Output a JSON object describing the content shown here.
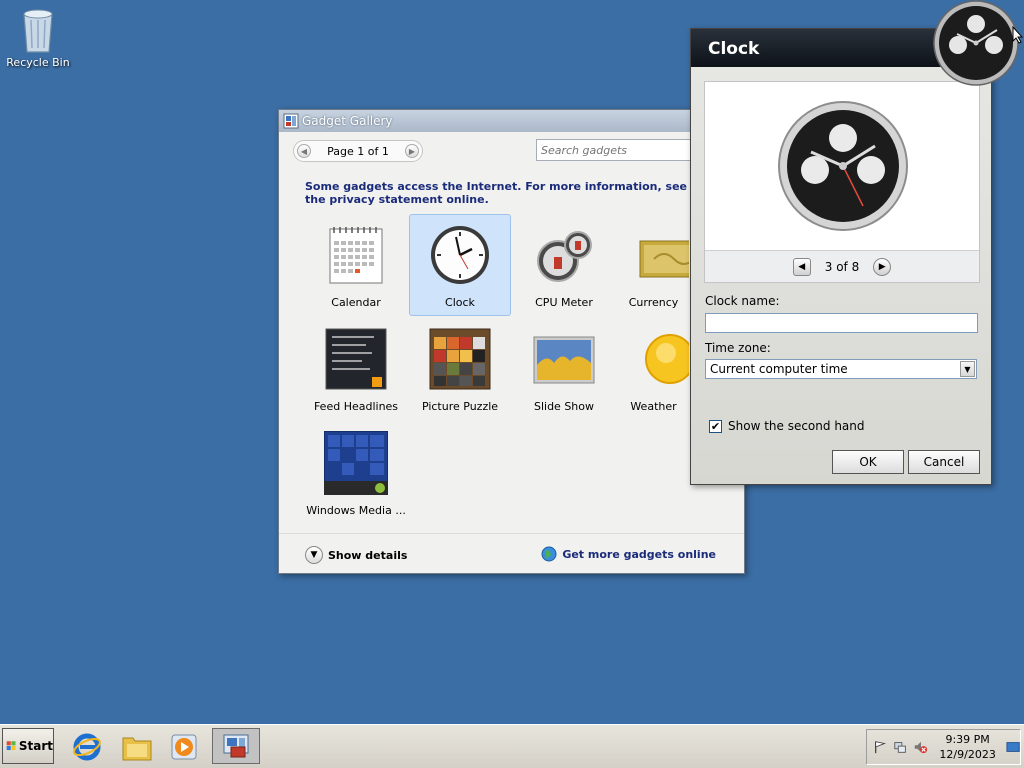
{
  "desktop": {
    "recycle_bin_label": "Recycle Bin"
  },
  "gallery": {
    "title": "Gadget Gallery",
    "pager_text": "Page 1 of 1",
    "search_placeholder": "Search gadgets",
    "notice": "Some gadgets access the Internet.  For more information, see the privacy statement online.",
    "gadgets": [
      {
        "name": "Calendar",
        "icon": "calendar-icon",
        "selected": false
      },
      {
        "name": "Clock",
        "icon": "clock-icon",
        "selected": true
      },
      {
        "name": "CPU Meter",
        "icon": "cpu-meter-icon",
        "selected": false
      },
      {
        "name": "Currency",
        "icon": "currency-icon",
        "selected": false
      },
      {
        "name": "Feed Headlines",
        "icon": "feed-headlines-icon",
        "selected": false
      },
      {
        "name": "Picture Puzzle",
        "icon": "picture-puzzle-icon",
        "selected": false
      },
      {
        "name": "Slide Show",
        "icon": "slide-show-icon",
        "selected": false
      },
      {
        "name": "Weather",
        "icon": "weather-icon",
        "selected": false
      },
      {
        "name": "Windows Media ...",
        "icon": "windows-media-center-icon",
        "selected": false
      }
    ],
    "show_details_label": "Show details",
    "get_more_label": "Get more gadgets online"
  },
  "clock_dialog": {
    "title": "Clock",
    "preview_counter": "3 of 8",
    "clock_name_label": "Clock name:",
    "clock_name_value": "",
    "time_zone_label": "Time zone:",
    "time_zone_value": "Current computer time",
    "second_hand_label": "Show the second hand",
    "second_hand_checked": true,
    "check_glyph": "✔",
    "ok_label": "OK",
    "cancel_label": "Cancel"
  },
  "taskbar": {
    "start_label": "Start",
    "time": "9:39 PM",
    "date": "12/9/2023",
    "pinned": [
      "internet-explorer-icon",
      "windows-explorer-icon",
      "media-player-icon",
      "gadget-gallery-icon"
    ]
  },
  "colors": {
    "desktop": "#3b6ea5",
    "link": "#1a2b7a",
    "selection": "#cfe3fb"
  }
}
